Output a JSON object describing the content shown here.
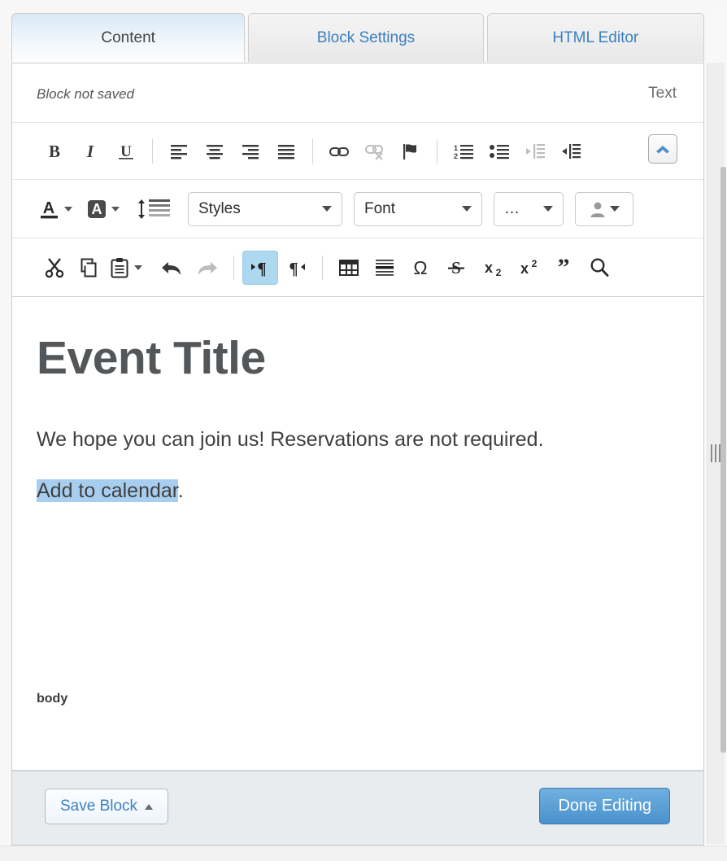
{
  "tabs": [
    {
      "label": "Content",
      "active": true
    },
    {
      "label": "Block Settings",
      "active": false
    },
    {
      "label": "HTML Editor",
      "active": false
    }
  ],
  "status": {
    "block_status": "Block not saved",
    "mode_label": "Text"
  },
  "toolbar_row_1": [
    {
      "name": "bold-icon",
      "title": "Bold"
    },
    {
      "name": "italic-icon",
      "title": "Italic"
    },
    {
      "name": "underline-icon",
      "title": "Underline"
    },
    {
      "name": "align-left-icon",
      "title": "Align Left"
    },
    {
      "name": "align-center-icon",
      "title": "Align Center"
    },
    {
      "name": "align-right-icon",
      "title": "Align Right"
    },
    {
      "name": "align-justify-icon",
      "title": "Justify"
    },
    {
      "name": "link-icon",
      "title": "Link"
    },
    {
      "name": "unlink-icon",
      "title": "Unlink"
    },
    {
      "name": "anchor-flag-icon",
      "title": "Anchor"
    },
    {
      "name": "numbered-list-icon",
      "title": "Numbered List"
    },
    {
      "name": "bulleted-list-icon",
      "title": "Bulleted List"
    },
    {
      "name": "outdent-icon",
      "title": "Decrease Indent"
    },
    {
      "name": "indent-icon",
      "title": "Increase Indent"
    }
  ],
  "toolbar_row_2": {
    "text_color_label": "A",
    "bg_color_label": "A",
    "line_height_title": "Line Height",
    "styles_label": "Styles",
    "font_label": "Font",
    "more_label": "…",
    "person_title": "Merge Fields"
  },
  "toolbar_row_3": [
    {
      "name": "cut-icon",
      "title": "Cut"
    },
    {
      "name": "copy-icon",
      "title": "Copy"
    },
    {
      "name": "paste-icon",
      "title": "Paste"
    },
    {
      "name": "undo-icon",
      "title": "Undo"
    },
    {
      "name": "redo-icon",
      "title": "Redo"
    },
    {
      "name": "text-direction-ltr-icon",
      "title": "Left to Right"
    },
    {
      "name": "text-direction-rtl-icon",
      "title": "Right to Left"
    },
    {
      "name": "table-icon",
      "title": "Table"
    },
    {
      "name": "horizontal-rule-icon",
      "title": "Horizontal Rule"
    },
    {
      "name": "special-character-icon",
      "title": "Special Character"
    },
    {
      "name": "strikethrough-icon",
      "title": "Strikethrough"
    },
    {
      "name": "subscript-icon",
      "title": "Subscript"
    },
    {
      "name": "superscript-icon",
      "title": "Superscript"
    },
    {
      "name": "blockquote-icon",
      "title": "Blockquote"
    },
    {
      "name": "search-icon",
      "title": "Find"
    }
  ],
  "collapse_toolbar": {
    "title": "Collapse Toolbar"
  },
  "document": {
    "title": "Event Title",
    "paragraph_1": "We hope you can join us! Reservations are not required.",
    "paragraph_2_selected": "Add to calendar",
    "paragraph_2_tail": ".",
    "element_path": "body"
  },
  "footer": {
    "save_block_label": "Save Block",
    "done_editing_label": "Done Editing"
  },
  "colors": {
    "accent_blue": "#3d80c2",
    "primary_button": "#4a91cc",
    "selection_highlight": "#a8ceef",
    "active_toolbar_button": "#aed8f0",
    "footer_background": "#e8ecef",
    "document_text": "#3f3f3f",
    "document_title": "#545759"
  }
}
